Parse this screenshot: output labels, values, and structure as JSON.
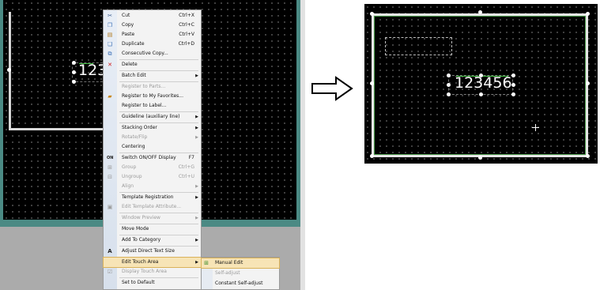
{
  "left_canvas": {
    "partial_text": "123"
  },
  "context_menu": {
    "items": [
      {
        "label": "Cut",
        "shortcut": "Ctrl+X",
        "icon": "scissors-icon"
      },
      {
        "label": "Copy",
        "shortcut": "Ctrl+C",
        "icon": "copy-icon"
      },
      {
        "label": "Paste",
        "shortcut": "Ctrl+V",
        "icon": "paste-icon"
      },
      {
        "label": "Duplicate",
        "shortcut": "Ctrl+D",
        "icon": "duplicate-icon"
      },
      {
        "label": "Consecutive Copy...",
        "icon": "consecutive-copy-icon"
      },
      {
        "label": "Delete",
        "icon": "delete-icon"
      },
      {
        "label": "Batch Edit"
      },
      {
        "label": "Register to Parts..."
      },
      {
        "label": "Register to My Favorites...",
        "icon": "favorites-icon"
      },
      {
        "label": "Register to Label..."
      },
      {
        "label": "Guideline (auxiliary line)"
      },
      {
        "label": "Stacking Order"
      },
      {
        "label": "Rotate/Flip"
      },
      {
        "label": "Centering"
      },
      {
        "label": "Switch ON/OFF Display",
        "shortcut": "F7",
        "icon": "on-icon"
      },
      {
        "label": "Group",
        "shortcut": "Ctrl+G",
        "icon": "group-icon"
      },
      {
        "label": "Ungroup",
        "shortcut": "Ctrl+U",
        "icon": "ungroup-icon"
      },
      {
        "label": "Align"
      },
      {
        "label": "Template Registration"
      },
      {
        "label": "Edit Template Attribute...",
        "icon": "template-icon"
      },
      {
        "label": "Window Preview"
      },
      {
        "label": "Move Mode"
      },
      {
        "label": "Add To Category"
      },
      {
        "label": "Adjust Direct Text Size",
        "icon": "text-size-icon"
      },
      {
        "label": "Edit Touch Area"
      },
      {
        "label": "Display Touch Area",
        "icon": "display-touch-icon"
      },
      {
        "label": "Set to Default"
      }
    ]
  },
  "submenu": {
    "items": [
      {
        "label": "Manual Edit",
        "icon": "manual-edit-icon"
      },
      {
        "label": "Self-adjust"
      },
      {
        "label": "Constant Self-adjust"
      }
    ]
  },
  "right_canvas": {
    "text": "123456"
  }
}
